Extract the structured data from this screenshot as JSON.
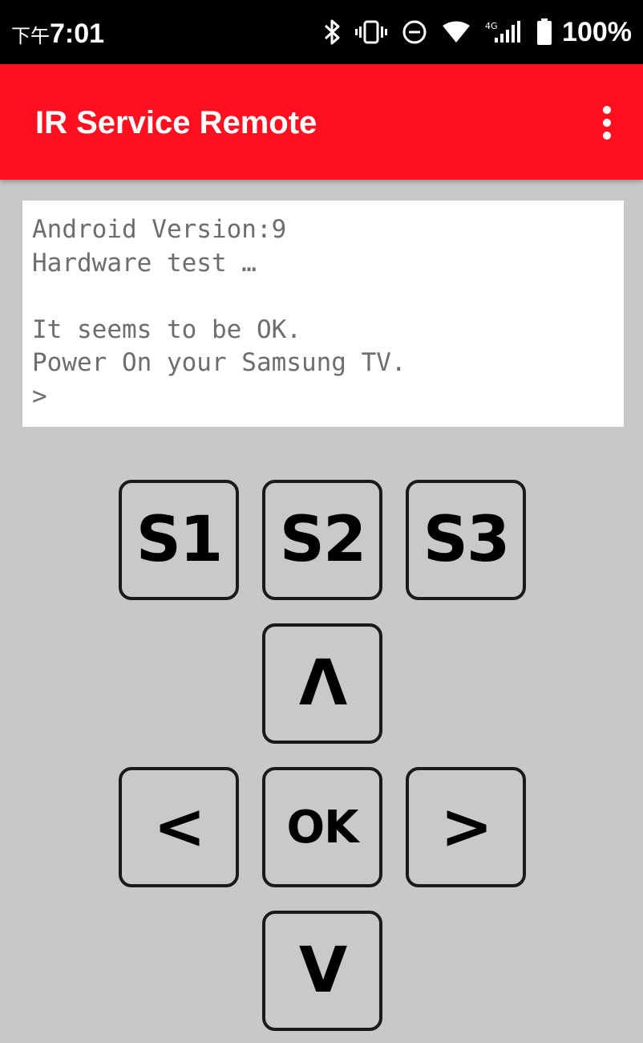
{
  "status_bar": {
    "time_prefix": "下午",
    "time": "7:01",
    "network_label": "4G",
    "battery_percent": "100%",
    "icons": [
      "bluetooth-icon",
      "vibrate-icon",
      "do-not-disturb-icon",
      "wifi-icon",
      "cellular-signal-icon",
      "battery-icon"
    ]
  },
  "app_bar": {
    "title": "IR Service Remote",
    "overflow_icon": "more-vert-icon",
    "color": "#ff1020"
  },
  "console": {
    "text": "Android Version:9\nHardware test …\n\nIt seems to be OK.\nPower On your Samsung TV.\n>"
  },
  "remote": {
    "s1": "S1",
    "s2": "S2",
    "s3": "S3",
    "up": "Λ",
    "left": "<",
    "ok": "OK",
    "right": ">",
    "down": "V"
  }
}
